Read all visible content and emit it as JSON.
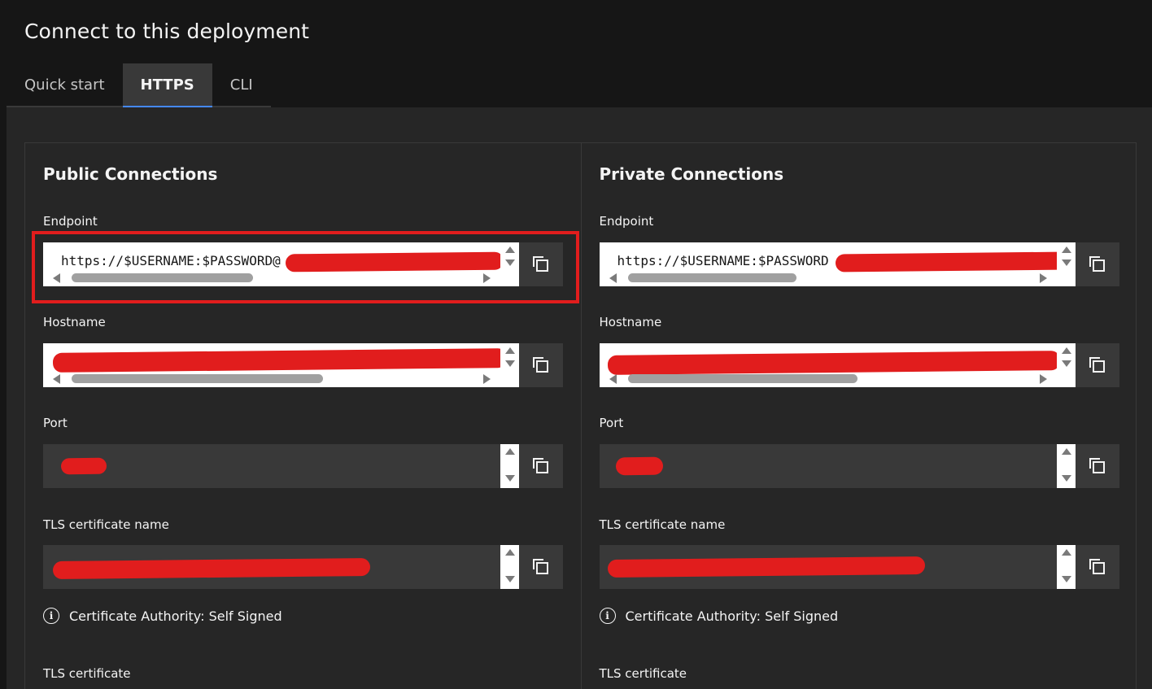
{
  "page_title": "Connect to this deployment",
  "tabs": [
    {
      "label": "Quick start",
      "active": false
    },
    {
      "label": "HTTPS",
      "active": true
    },
    {
      "label": "CLI",
      "active": false
    }
  ],
  "panels": {
    "public": {
      "title": "Public Connections",
      "endpoint_label": "Endpoint",
      "endpoint_value": "https://$USERNAME:$PASSWORD@",
      "hostname_label": "Hostname",
      "port_label": "Port",
      "tls_name_label": "TLS certificate name",
      "ca_text": "Certificate Authority: Self Signed",
      "tls_cert_label": "TLS certificate"
    },
    "private": {
      "title": "Private Connections",
      "endpoint_label": "Endpoint",
      "endpoint_value": "https://$USERNAME:$PASSWORD",
      "hostname_label": "Hostname",
      "port_label": "Port",
      "tls_name_label": "TLS certificate name",
      "ca_text": "Certificate Authority: Self Signed",
      "tls_cert_label": "TLS certificate"
    }
  },
  "icons": {
    "copy": "copy-icon",
    "info": "information-icon",
    "info_glyph": "i"
  },
  "colors": {
    "accent": "#4589ff",
    "redaction": "#e11d1d",
    "background": "#161616",
    "surface": "#262626"
  }
}
